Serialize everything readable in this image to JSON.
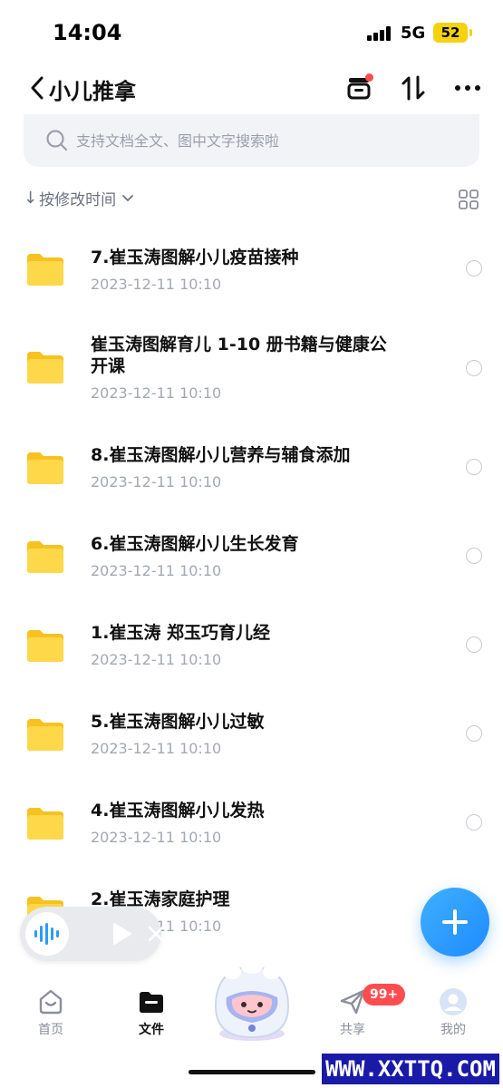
{
  "status_bar": {
    "time": "14:04",
    "network": "5G",
    "battery": "52"
  },
  "header": {
    "title": "小儿推拿"
  },
  "search": {
    "placeholder": "支持文档全文、图中文字搜索啦"
  },
  "sort": {
    "label": "按修改时间"
  },
  "files": [
    {
      "name": "7.崔玉涛图解小儿疫苗接种",
      "date": "2023-12-11 10:10"
    },
    {
      "name": "崔玉涛图解育儿 1-10 册书籍与健康公开课",
      "date": "2023-12-11 10:10"
    },
    {
      "name": "8.崔玉涛图解小儿营养与辅食添加",
      "date": "2023-12-11 10:10"
    },
    {
      "name": "6.崔玉涛图解小儿生长发育",
      "date": "2023-12-11 10:10"
    },
    {
      "name": "1.崔玉涛 郑玉巧育儿经",
      "date": "2023-12-11 10:10"
    },
    {
      "name": "5.崔玉涛图解小儿过敏",
      "date": "2023-12-11 10:10"
    },
    {
      "name": "4.崔玉涛图解小儿发热",
      "date": "2023-12-11 10:10"
    },
    {
      "name": "2.崔玉涛家庭护理",
      "date": "2023-12-11 10:10"
    }
  ],
  "tabs": [
    {
      "label": "首页",
      "icon": "home-icon"
    },
    {
      "label": "文件",
      "icon": "folder-tab-icon"
    },
    {
      "label": "共享",
      "icon": "share-icon"
    },
    {
      "label": "我的",
      "icon": "profile-icon"
    }
  ],
  "share_badge": "99+",
  "watermark": "WWW.XXTTQ.COM",
  "colors": {
    "accent": "#1e8bff",
    "folder": "#ffd43b",
    "badge": "#ff4d4f",
    "watermark_bg": "#1a1aa8"
  }
}
